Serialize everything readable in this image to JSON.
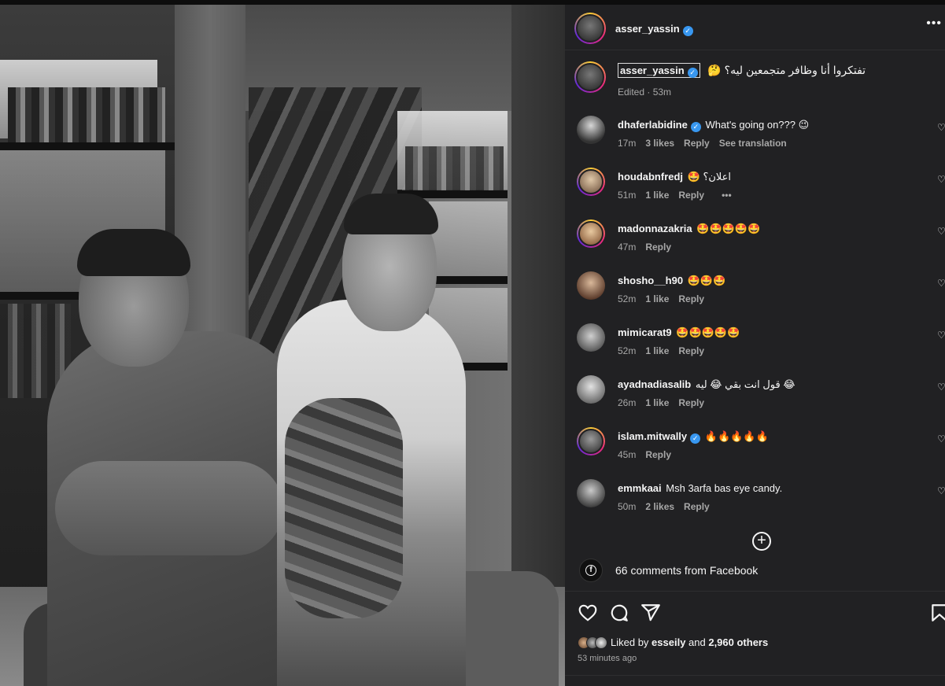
{
  "post": {
    "author": "asser_yassin",
    "caption": "تفتكروا أنا وظافر متجمعين ليه؟ 🤔",
    "caption_meta": "Edited · 53m"
  },
  "comments": [
    {
      "user": "dhaferlabidine",
      "verified": true,
      "text": "What's going on??? 😉",
      "time": "17m",
      "likes": "3 likes",
      "reply": "Reply",
      "extra": "See translation"
    },
    {
      "user": "houdabnfredj",
      "verified": false,
      "text": "اعلان؟ 🤩",
      "time": "51m",
      "likes": "1 like",
      "reply": "Reply",
      "extra": "•••"
    },
    {
      "user": "madonnazakria",
      "verified": false,
      "text": "🤩🤩🤩🤩🤩",
      "time": "47m",
      "likes": "",
      "reply": "Reply",
      "extra": ""
    },
    {
      "user": "shosho__h90",
      "verified": false,
      "text": "🤩🤩🤩",
      "time": "52m",
      "likes": "1 like",
      "reply": "Reply",
      "extra": ""
    },
    {
      "user": "mimicarat9",
      "verified": false,
      "text": "🤩🤩🤩🤩🤩",
      "time": "52m",
      "likes": "1 like",
      "reply": "Reply",
      "extra": ""
    },
    {
      "user": "ayadnadiasalib",
      "verified": false,
      "text": "😂 قول انت بقي 😂 ليه",
      "time": "26m",
      "likes": "1 like",
      "reply": "Reply",
      "extra": ""
    },
    {
      "user": "islam.mitwally",
      "verified": true,
      "text": "🔥🔥🔥🔥🔥",
      "time": "45m",
      "likes": "",
      "reply": "Reply",
      "extra": ""
    },
    {
      "user": "emmkaai",
      "verified": false,
      "text": "Msh 3arfa bas eye candy.",
      "time": "50m",
      "likes": "2 likes",
      "reply": "Reply",
      "extra": ""
    }
  ],
  "facebook_comments": "66 comments from Facebook",
  "likes": {
    "prefix": "Liked by ",
    "first_user": "esseily",
    "middle": " and ",
    "others": "2,960 others"
  },
  "timestamp": "53 minutes ago",
  "icons": {
    "verified": "✓",
    "more": "•••",
    "load_more": "+",
    "facebook": "f",
    "heart": "♡"
  },
  "colors": {
    "background": "#212123",
    "verified": "#3897f0",
    "muted_text": "#a8a8a8"
  }
}
